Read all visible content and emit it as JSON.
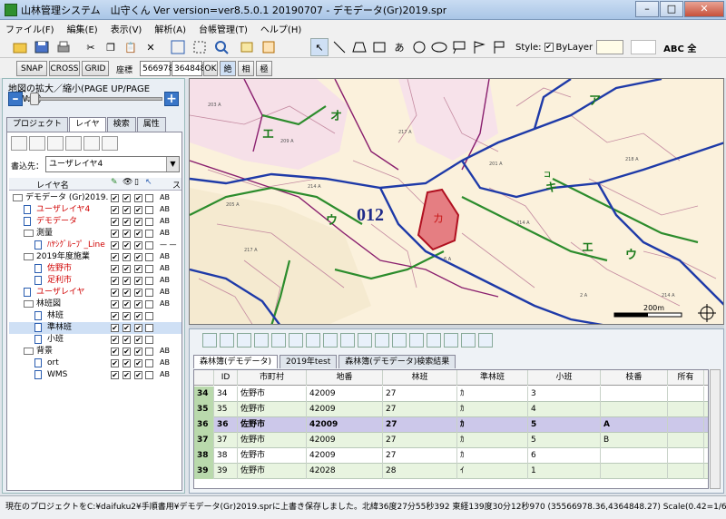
{
  "window": {
    "title": "山林管理システム　山守くん Ver version=ver8.5.0.1 20190707 - デモデータ(Gr)2019.spr",
    "minimize": "–",
    "maximize": "□",
    "close": "✕"
  },
  "menu": [
    "ファイル(F)",
    "編集(E)",
    "表示(V)",
    "解析(A)",
    "台帳管理(T)",
    "ヘルプ(H)"
  ],
  "style": {
    "label": "Style:",
    "bylayer": "ByLayer",
    "abc": "ABC 全"
  },
  "toolbar2": {
    "snap": "SNAP",
    "cross": "CROSS",
    "grid": "GRID",
    "coord_label": "座標",
    "coord_x": "566978",
    "coord_y": "364848",
    "ok": "OK",
    "abs": "絶",
    "rel": "相",
    "polar": "極"
  },
  "left": {
    "zoom_label": "地図の拡大／縮小(PAGE UP/PAGE DOWN)",
    "zoom_minus": "–",
    "zoom_plus": "+",
    "tabs": [
      "プロジェクト",
      "レイヤ",
      "検索",
      "属性"
    ],
    "dest_label": "書込先：",
    "dest_value": "ユーザレイヤ4",
    "layer_col": "レイヤ名",
    "s_col": "ス"
  },
  "layers": [
    {
      "name": "デモデータ (Gr)2019.",
      "indent": 0,
      "type": "folder",
      "color": "#000000",
      "sym": "AB"
    },
    {
      "name": "ユーザレイヤ4",
      "indent": 1,
      "type": "doc",
      "color": "#d00000",
      "sym": "AB"
    },
    {
      "name": "デモデータ",
      "indent": 1,
      "type": "doc",
      "color": "#d00000",
      "sym": "AB"
    },
    {
      "name": "測量",
      "indent": 1,
      "type": "folder",
      "color": "#000000",
      "sym": "AB"
    },
    {
      "name": "ﾊﾔｼｸﾞﾙｰﾌﾟ_Line",
      "indent": 2,
      "type": "doc",
      "color": "#d00000",
      "sym": "— —"
    },
    {
      "name": "2019年度施業",
      "indent": 1,
      "type": "folder",
      "color": "#000000",
      "sym": "AB"
    },
    {
      "name": "佐野市",
      "indent": 2,
      "type": "doc",
      "color": "#d00000",
      "sym": "AB"
    },
    {
      "name": "足利市",
      "indent": 2,
      "type": "doc",
      "color": "#d00000",
      "sym": "AB"
    },
    {
      "name": "ユーザレイヤ",
      "indent": 1,
      "type": "doc",
      "color": "#d00000",
      "sym": "AB"
    },
    {
      "name": "林班図",
      "indent": 1,
      "type": "folder",
      "color": "#000000",
      "sym": "AB"
    },
    {
      "name": "林班",
      "indent": 2,
      "type": "doc",
      "color": "#000000",
      "sym": ""
    },
    {
      "name": "準林班",
      "indent": 2,
      "type": "doc",
      "color": "#000000",
      "sym": ""
    },
    {
      "name": "小班",
      "indent": 2,
      "type": "doc",
      "color": "#000000",
      "sym": ""
    },
    {
      "name": "背景",
      "indent": 1,
      "type": "folder",
      "color": "#000000",
      "sym": "AB"
    },
    {
      "name": "ort",
      "indent": 2,
      "type": "doc",
      "color": "#000000",
      "sym": "AB"
    },
    {
      "name": "WMS",
      "indent": 2,
      "type": "doc",
      "color": "#000000",
      "sym": "AB"
    }
  ],
  "map": {
    "big_label": "012",
    "red_label": "カ",
    "katakana": [
      "オ",
      "エ",
      "ア",
      "ウ",
      "キ",
      "エ",
      "ウ",
      "コ"
    ],
    "scale": "200m"
  },
  "bottom": {
    "tabs": [
      "森林簿(デモデータ)",
      "2019年test",
      "森林簿(デモデータ)検索結果"
    ],
    "columns": [
      "",
      "ID",
      "市町村",
      "地番",
      "林班",
      "準林班",
      "小班",
      "枝番",
      "所有"
    ],
    "rows": [
      [
        "34",
        "34",
        "佐野市",
        "42009",
        "27",
        "ｶ",
        "3",
        "",
        ""
      ],
      [
        "35",
        "35",
        "佐野市",
        "42009",
        "27",
        "ｶ",
        "4",
        "",
        ""
      ],
      [
        "36",
        "36",
        "佐野市",
        "42009",
        "27",
        "ｶ",
        "5",
        "A",
        ""
      ],
      [
        "37",
        "37",
        "佐野市",
        "42009",
        "27",
        "ｶ",
        "5",
        "B",
        ""
      ],
      [
        "38",
        "38",
        "佐野市",
        "42009",
        "27",
        "ｶ",
        "6",
        "",
        ""
      ],
      [
        "39",
        "39",
        "佐野市",
        "42028",
        "28",
        "ｲ",
        "1",
        "",
        ""
      ]
    ]
  },
  "status": "現在のプロジェクトをC:¥daifuku2¥手順書用¥デモデータ(Gr)2019.sprに上書き保存しました。北緯36度27分55秒392 東経139度30分12秒970 (35566978.36,4364848.27) Scale(0.42=1/6091)"
}
